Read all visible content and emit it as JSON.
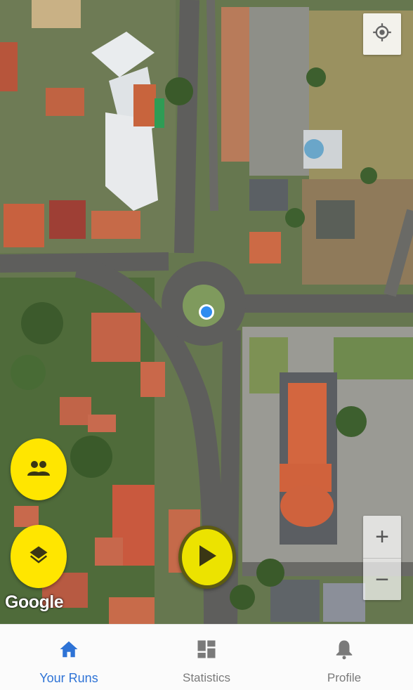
{
  "map": {
    "attribution": "Google",
    "controls": {
      "locate_icon": "my-location-icon",
      "zoom_in_label": "+",
      "zoom_out_label": "−"
    }
  },
  "fabs": {
    "group_icon": "group-icon",
    "layers_icon": "layers-icon",
    "play_icon": "play-icon"
  },
  "colors": {
    "fab": "#ffe600",
    "active_nav": "#2e73d6",
    "inactive_nav": "#7a7a7a",
    "location_dot": "#2f8cf0"
  },
  "bottom_nav": {
    "items": [
      {
        "label": "Your Runs",
        "icon": "home-icon",
        "active": true
      },
      {
        "label": "Statistics",
        "icon": "dashboard-icon",
        "active": false
      },
      {
        "label": "Profile",
        "icon": "bell-icon",
        "active": false
      }
    ]
  }
}
